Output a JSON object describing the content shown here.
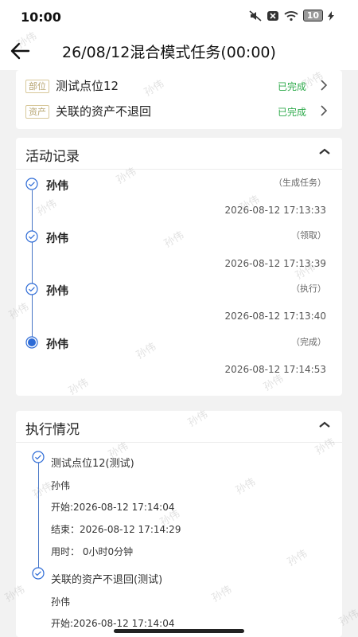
{
  "status_bar": {
    "time": "10:00",
    "battery": "10"
  },
  "header": {
    "title": "26/08/12混合模式任务(00:00)"
  },
  "items": [
    {
      "tag": "部位",
      "name": "测试点位12",
      "status": "已完成"
    },
    {
      "tag": "资产",
      "name": "关联的资产不退回",
      "status": "已完成"
    }
  ],
  "activity": {
    "title": "活动记录",
    "records": [
      {
        "name": "孙伟",
        "action": "（生成任务）",
        "time": "2026-08-12 17:13:33"
      },
      {
        "name": "孙伟",
        "action": "（领取）",
        "time": "2026-08-12 17:13:39"
      },
      {
        "name": "孙伟",
        "action": "（执行）",
        "time": "2026-08-12 17:13:40"
      },
      {
        "name": "孙伟",
        "action": "（完成）",
        "time": "2026-08-12 17:14:53"
      }
    ]
  },
  "execution": {
    "title": "执行情况",
    "entries": [
      {
        "point": "测试点位12(测试)",
        "person": "孙伟",
        "start": "开始:2026-08-12 17:14:04",
        "end": "结束：2026-08-12 17:14:29",
        "duration": "用时： 0小时0分钟"
      },
      {
        "point": "关联的资产不退回(测试)",
        "person": "孙伟",
        "start": "开始:2026-08-12 17:14:04"
      }
    ]
  },
  "watermark_text": "孙伟",
  "colors": {
    "accent": "#2d6bd6",
    "done": "#2eaa4b",
    "tag": "#b7a571"
  }
}
